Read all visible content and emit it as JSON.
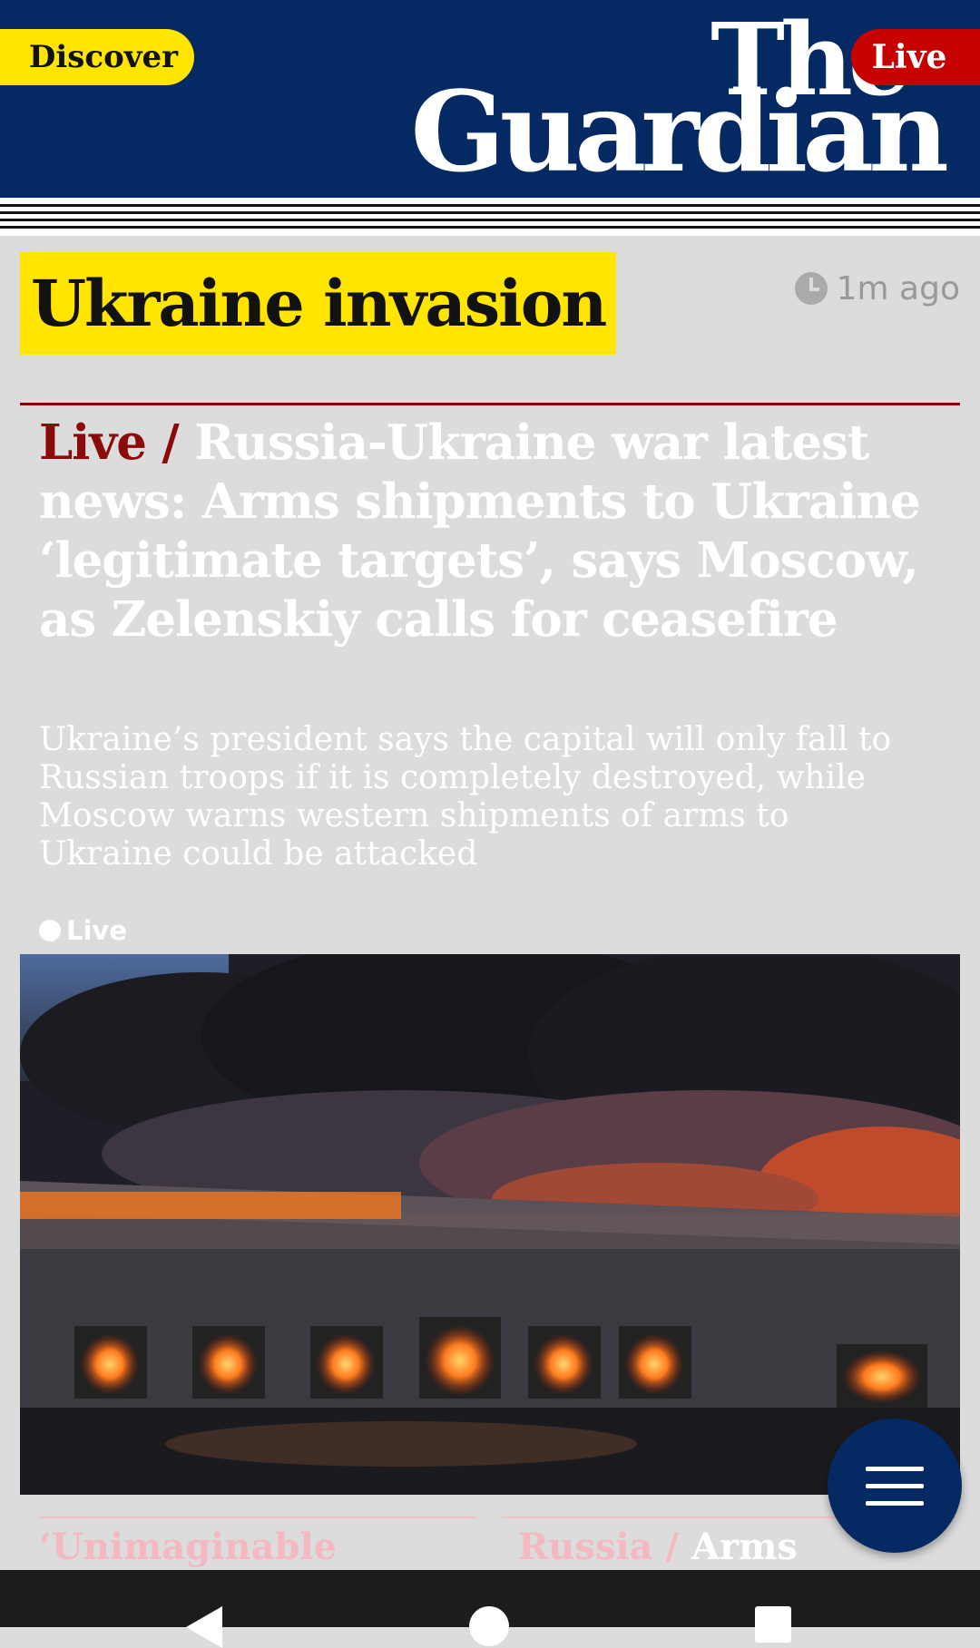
{
  "header": {
    "discover_label": "Discover",
    "live_label": "Live",
    "logo_line1": "The",
    "logo_line2": "Guardian",
    "brand_color": "#052962"
  },
  "article": {
    "section_tag": "Ukraine invasion",
    "timestamp": "1m ago",
    "kicker": "Live /",
    "headline": "Russia-Ukraine war latest news: Arms shipments to Ukraine ‘legitimate targets’, says Moscow, as Zelenskiy calls for ceasefire",
    "standfirst": "Ukraine’s president says the capital will only fall to Russian troops if it is completely destroyed, while Moscow warns western shipments of arms to Ukraine could be attacked",
    "live_badge": "Live",
    "image_description_icon": "burning-warehouse-photo"
  },
  "teasers": {
    "left_kicker": "‘Unimaginable",
    "right_kicker": "Russia /",
    "right_title": "Arms"
  },
  "fab": {
    "icon": "menu-icon"
  },
  "navbar": {
    "icons": [
      "back-icon",
      "home-icon",
      "recents-icon"
    ]
  }
}
